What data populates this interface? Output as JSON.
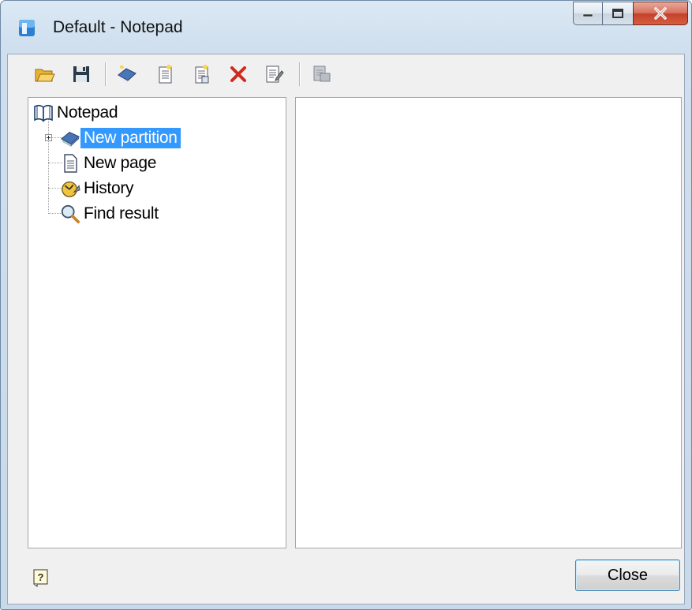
{
  "window": {
    "title": "Default - Notepad"
  },
  "toolbar": {
    "items": [
      {
        "icon": "open-folder-icon"
      },
      {
        "icon": "save-icon"
      },
      {
        "icon": "new-partition-icon"
      },
      {
        "icon": "new-page-icon"
      },
      {
        "icon": "new-subpage-icon"
      },
      {
        "icon": "delete-icon"
      },
      {
        "icon": "edit-icon"
      },
      {
        "icon": "export-icon"
      }
    ]
  },
  "tree": {
    "root": {
      "label": "Notepad",
      "icon": "book-icon"
    },
    "children": [
      {
        "label": "New partition",
        "icon": "partition-icon",
        "selected": true,
        "expandable": true
      },
      {
        "label": "New page",
        "icon": "page-icon"
      },
      {
        "label": "History",
        "icon": "history-icon"
      },
      {
        "label": "Find result",
        "icon": "magnifier-icon"
      }
    ]
  },
  "footer": {
    "close_label": "Close",
    "help_icon": "help-icon"
  },
  "colors": {
    "selection": "#3399ff",
    "close_button_red": "#c4412a"
  }
}
